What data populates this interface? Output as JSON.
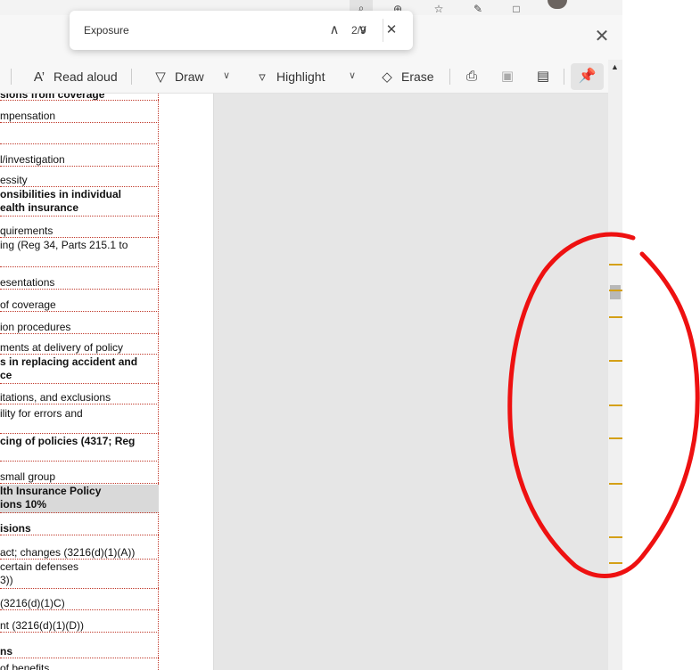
{
  "find": {
    "query": "Exposure",
    "match_count": "2/9",
    "prev_icon": "chevron-up-icon",
    "next_icon": "chevron-down-icon",
    "close_icon": "close-icon"
  },
  "toolbar": {
    "read_aloud": "Read aloud",
    "draw": "Draw",
    "highlight": "Highlight",
    "erase": "Erase"
  },
  "toc": [
    "sions from coverage",
    "mpensation",
    "",
    "l/investigation",
    "essity",
    "onsibilities in individual",
    "ealth insurance",
    "quirements",
    "ing (Reg 34, Parts 215.1 to",
    "esentations",
    "of coverage",
    "ion procedures",
    "ments at delivery of policy",
    "s in replacing accident and",
    "ce",
    "itations, and exclusions",
    "ility for errors and",
    "cing of policies (4317; Reg",
    "small group",
    "lth Insurance Policy",
    "ions 10%",
    "isions",
    "act; changes (3216(d)(1)(A))",
    "certain defenses",
    "3))",
    "(3216(d)(1)C)",
    "nt (3216(d)(1)(D))",
    "ns",
    "of benefits"
  ],
  "colors": {
    "annotation": "#ee1111",
    "search_marker": "#d4a017",
    "toc_border": "#c0392b"
  }
}
